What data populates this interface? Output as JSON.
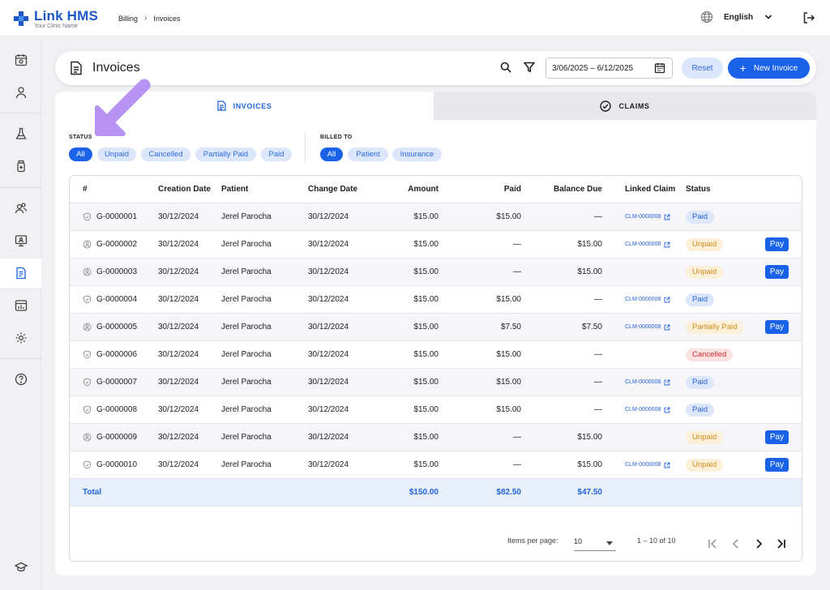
{
  "app": {
    "name": "Link HMS",
    "subtitle": "Your Clinic Name",
    "brand_color": "#1f57c7"
  },
  "breadcrumb": [
    "Billing",
    "Invoices"
  ],
  "language": {
    "selected": "English"
  },
  "sidebar": {
    "items": [
      {
        "icon": "calendar-icon"
      },
      {
        "icon": "person-icon"
      },
      {
        "icon": "flask-icon"
      },
      {
        "icon": "medicine-bottle-icon"
      },
      {
        "icon": "users-icon"
      },
      {
        "icon": "monitor-icon"
      },
      {
        "icon": "invoice-icon",
        "active": true
      },
      {
        "icon": "report-icon"
      },
      {
        "icon": "gear-icon"
      },
      {
        "icon": "help-icon"
      },
      {
        "icon": "graduation-cap-icon"
      }
    ]
  },
  "page": {
    "title": "Invoices",
    "date_range": "3/06/2025 – 6/12/2025",
    "reset_label": "Reset",
    "new_label": "New Invoice"
  },
  "tabs": {
    "invoices": "INVOICES",
    "claims": "CLAIMS",
    "active": "invoices"
  },
  "filters": {
    "status": {
      "label": "STATUS",
      "options": [
        "All",
        "Unpaid",
        "Cancelled",
        "Partially Paid",
        "Paid"
      ],
      "selected": "All"
    },
    "billed_to": {
      "label": "BILLED TO",
      "options": [
        "All",
        "Patient",
        "Insurance"
      ],
      "selected": "All"
    }
  },
  "table": {
    "columns": [
      "#",
      "Creation Date",
      "Patient",
      "Change Date",
      "Amount",
      "Paid",
      "Balance Due",
      "Linked Claim",
      "Status"
    ],
    "rows": [
      {
        "id": "G-0000001",
        "billed": "insurance",
        "created": "30/12/2024",
        "patient": "Jerel Parocha",
        "changed": "30/12/2024",
        "amount": "$15.00",
        "paid": "$15.00",
        "balance": "—",
        "claim": "CLM-0000008",
        "status": "Paid",
        "pay": ""
      },
      {
        "id": "G-0000002",
        "billed": "patient",
        "created": "30/12/2024",
        "patient": "Jerel Parocha",
        "changed": "30/12/2024",
        "amount": "$15.00",
        "paid": "—",
        "balance": "$15.00",
        "claim": "CLM-0000008",
        "status": "Unpaid",
        "pay": "Pay"
      },
      {
        "id": "G-0000003",
        "billed": "patient",
        "created": "30/12/2024",
        "patient": "Jerel Parocha",
        "changed": "30/12/2024",
        "amount": "$15.00",
        "paid": "—",
        "balance": "$15.00",
        "claim": "",
        "status": "Unpaid",
        "pay": "Pay"
      },
      {
        "id": "G-0000004",
        "billed": "insurance",
        "created": "30/12/2024",
        "patient": "Jerel Parocha",
        "changed": "30/12/2024",
        "amount": "$15.00",
        "paid": "$15.00",
        "balance": "—",
        "claim": "CLM-0000008",
        "status": "Paid",
        "pay": ""
      },
      {
        "id": "G-0000005",
        "billed": "patient",
        "created": "30/12/2024",
        "patient": "Jerel Parocha",
        "changed": "30/12/2024",
        "amount": "$15.00",
        "paid": "$7.50",
        "balance": "$7.50",
        "claim": "CLM-0000008",
        "status": "Partially Paid",
        "pay": "Pay"
      },
      {
        "id": "G-0000006",
        "billed": "insurance",
        "created": "30/12/2024",
        "patient": "Jerel Parocha",
        "changed": "30/12/2024",
        "amount": "$15.00",
        "paid": "$15.00",
        "balance": "—",
        "claim": "",
        "status": "Cancelled",
        "pay": ""
      },
      {
        "id": "G-0000007",
        "billed": "insurance",
        "created": "30/12/2024",
        "patient": "Jerel Parocha",
        "changed": "30/12/2024",
        "amount": "$15.00",
        "paid": "$15.00",
        "balance": "—",
        "claim": "CLM-0000008",
        "status": "Paid",
        "pay": ""
      },
      {
        "id": "G-0000008",
        "billed": "insurance",
        "created": "30/12/2024",
        "patient": "Jerel Parocha",
        "changed": "30/12/2024",
        "amount": "$15.00",
        "paid": "$15.00",
        "balance": "—",
        "claim": "CLM-0000008",
        "status": "Paid",
        "pay": ""
      },
      {
        "id": "G-0000009",
        "billed": "patient",
        "created": "30/12/2024",
        "patient": "Jerel Parocha",
        "changed": "30/12/2024",
        "amount": "$15.00",
        "paid": "—",
        "balance": "$15.00",
        "claim": "",
        "status": "Unpaid",
        "pay": "Pay"
      },
      {
        "id": "G-0000010",
        "billed": "insurance",
        "created": "30/12/2024",
        "patient": "Jerel Parocha",
        "changed": "30/12/2024",
        "amount": "$15.00",
        "paid": "—",
        "balance": "$15.00",
        "claim": "CLM-0000008",
        "status": "Unpaid",
        "pay": "Pay"
      }
    ],
    "total": {
      "label": "Total",
      "amount": "$150.00",
      "paid": "$82.50",
      "balance": "$47.50"
    }
  },
  "pagination": {
    "items_label": "Items per page:",
    "items_value": "10",
    "range": "1 – 10 of 10"
  },
  "colors": {
    "primary": "#1a63e8",
    "chip_bg": "#dde7fb",
    "paid": "#2463db",
    "unpaid": "#d08a1c",
    "cancelled": "#d03030",
    "annotation_arrow": "#b794f4"
  }
}
